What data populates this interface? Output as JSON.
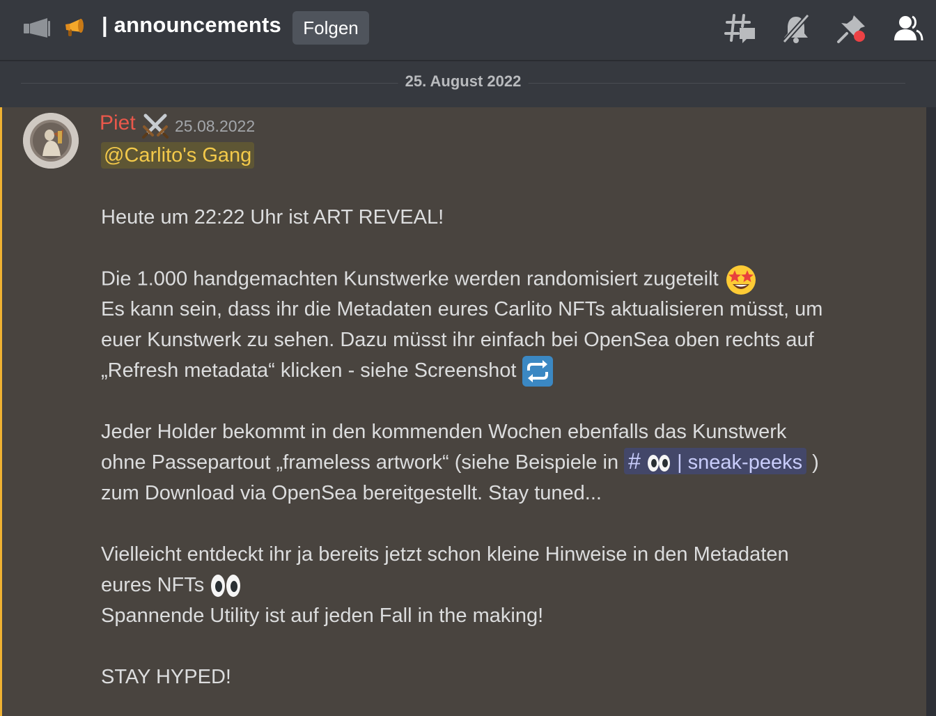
{
  "header": {
    "channel_title": "| announcements",
    "follow_label": "Folgen"
  },
  "divider": {
    "date": "25. August 2022"
  },
  "message": {
    "author": "Piet",
    "timestamp": "25.08.2022",
    "mention": "@Carlito's Gang",
    "line1": "Heute um 22:22 Uhr ist ART REVEAL!",
    "line2": "Die 1.000 handgemachten Kunstwerke werden randomisiert zugeteilt",
    "line3": "Es kann sein, dass ihr die Metadaten eures Carlito NFTs aktualisieren müsst, um",
    "line4": "euer Kunstwerk zu sehen. Dazu müsst ihr einfach bei OpenSea oben rechts auf",
    "line5": "„Refresh metadata“ klicken - siehe Screenshot",
    "line6": "Jeder Holder bekommt in den kommenden Wochen ebenfalls das Kunstwerk",
    "line7_pre": "ohne Passepartout „frameless artwork“ (siehe Beispiele in",
    "channel_link_hash": "#",
    "channel_link_name": "| sneak-peeks",
    "line7_post": ")",
    "line8": "zum Download via OpenSea bereitgestellt. Stay tuned...",
    "line9": "Vielleicht entdeckt ihr ja bereits jetzt schon kleine Hinweise in den Metadaten",
    "line10": "eures NFTs",
    "line11": "Spannende Utility ist auf jeden Fall in the making!",
    "line12": "STAY HYPED!"
  },
  "icons": {
    "header_left": "announcement-channel-icon",
    "header_emoji": "megaphone-emoji",
    "threads": "threads-icon",
    "mute": "bell-slash-icon",
    "pins": "pin-icon",
    "members": "member-list-icon",
    "author_badge": "crossed-swords-emoji",
    "star_struck": "star-struck-emoji",
    "repeat": "repeat-button-emoji",
    "eyes": "eyes-emoji"
  },
  "colors": {
    "background": "#36393f",
    "highlight": "#49443f",
    "highlight_border": "#f0b232",
    "author": "#e9584b",
    "mention_text": "#f3c94a",
    "channel_link_bg": "#434769"
  }
}
